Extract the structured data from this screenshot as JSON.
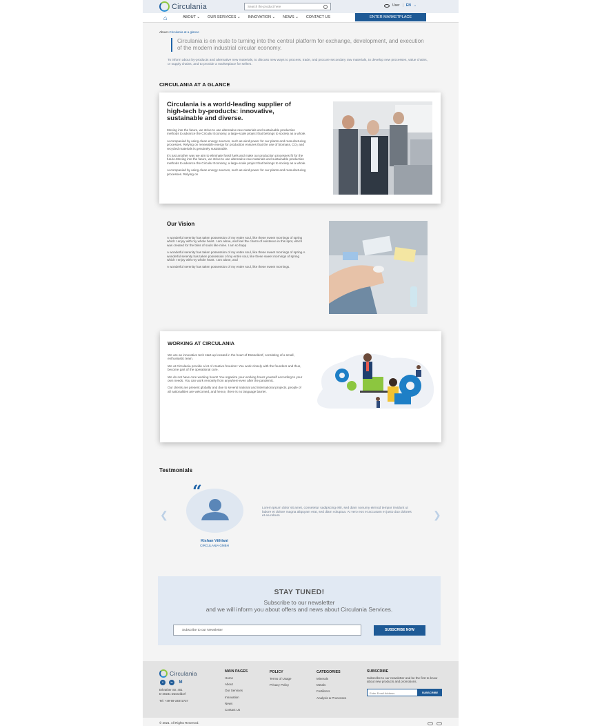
{
  "header": {
    "logo_text": "Circulania",
    "search_placeholder": "Search the product here",
    "user_label": "User",
    "lang": "EN"
  },
  "nav": {
    "items": [
      "ABOUT",
      "OUR SERVICES",
      "INNOVATION",
      "NEWS",
      "CONTACT US"
    ],
    "cta": "ENTER MARKETPLACE"
  },
  "breadcrumb": {
    "root": "About",
    "current": "Circulania at a glance"
  },
  "lead": "Circulania is en route to turning into the central platform for exchange, development, and execution of the modern industrial circular economy.",
  "intro": "To inform about by-products and alternative new materials, to discuss new ways to process, trade, and procure secondary raw materials, to develop new processes, value chains, or supply chains, and to provide a marketplace for sellers.",
  "glance": {
    "section_title": "CIRCULANIA AT A GLANCE",
    "heading": "Circulania is a world-leading supplier of high-tech by-products: innovative, sustainable and diverse.",
    "paragraphs": [
      "Moving into the future, we strive to use alternative raw materials and sustainable production methods to advance the Circular Economy, a large-scale project that belongs to society as a whole.",
      " Accompanied by using clean energy sources, such as wind power for our plants and manufacturing processes. Relying on renewable energy for production ensures that the use of biomass, CO₂ and recycled materials is genuinely sustainable.",
      " It's just another way we aim to eliminate fossil fuels and make our production processes fit for the future.Moving into the future, we strive to use alternative raw materials and sustainable production methods to advance the Circular Economy, a large-scale project that belongs to society as a whole.",
      " Accompanied by using clean energy sources, such as wind power for our plants and manufacturing processes. Relying on"
    ]
  },
  "vision": {
    "heading": "Our Vision",
    "paragraphs": [
      "A wonderful serenity has taken possession of my entire soul, like these sweet mornings of spring which I enjoy with my whole heart. I am alone, and feel the charm of existence in this spot, which was created for the bliss of souls like mine. I am so happ",
      "A wonderful serenity has taken possession of my entire soul, like these sweet mornings of spring.A wonderful serenity has taken possession of my entire soul, like these sweet mornings of spring which I enjoy with my whole heart. I am alone, and",
      "A wonderful serenity has taken possession of my entire soul, like these sweet mornings."
    ]
  },
  "working": {
    "heading": "WORKING AT CIRCULANIA",
    "paragraphs": [
      "We are an innovative tech start-up located in the heart of Düsseldorf, consisting of a small, enthusiastic team.",
      "We at Circulania provide a lot of creative freedom: You work closely with the founders and thus, become part of the operational core.",
      "We do not have core working hours! You organize your working hours yourself according to your own needs. You can work remotely from anywhere even after the pandemic.",
      "Our clients  are present globally and due to several national and international projects, people of all nationalities are welcomed, and hence, there is no language barrier."
    ]
  },
  "testimonials": {
    "title": "Testmonials",
    "text": "Lorem ipsum dolor sit amet, consetetur sadipscing elitr, sed diam nonumy eirmod tempor invidunt ut labore et dolore magna aliquyam erat, sed diam voluptua. At vero eos et accusam et justo duo dolores et ea rebum",
    "name": "Kishan Vithlani",
    "company": "CIRCULANIA GMBH"
  },
  "newsletter": {
    "title": "STAY TUNED!",
    "line1": "Subscribe to our newsletter",
    "line2": "and we will inform you about offers and news about Circulania Services.",
    "placeholder": "Subscribe to our Newsletter",
    "button": "SUBSCRIBE NOW"
  },
  "footer": {
    "logo_text": "Circulania",
    "address": [
      "Erkrather Str. 401",
      "D-40231 Düsseldorf"
    ],
    "phone": "Tel: +49-69-34872737",
    "main_pages": {
      "heading": "MAIN PAGES",
      "items": [
        "Home",
        "About",
        "Our Services",
        "Innovation",
        "News",
        "Contact Us"
      ]
    },
    "policy": {
      "heading": "POLICY",
      "items": [
        "Terms of Usage",
        "Privacy Policy"
      ]
    },
    "categories": {
      "heading": "CATEGORIES",
      "items": [
        "Minerals",
        "Metals",
        "Fertilizers",
        "Analysis & Processes"
      ]
    },
    "subscribe": {
      "heading": "SUBSCRIBE",
      "text": "Subscribe to our newsletter and be the first to know about new products and promotions.",
      "placeholder": "Enter Email Address",
      "button": "SUBSCRIBE"
    },
    "copyright": "© 2021. All Rights Reserved."
  },
  "colors": {
    "accent": "#1e5a96",
    "brand_green": "#8cc63f",
    "page_bg": "#f4f4f4"
  }
}
